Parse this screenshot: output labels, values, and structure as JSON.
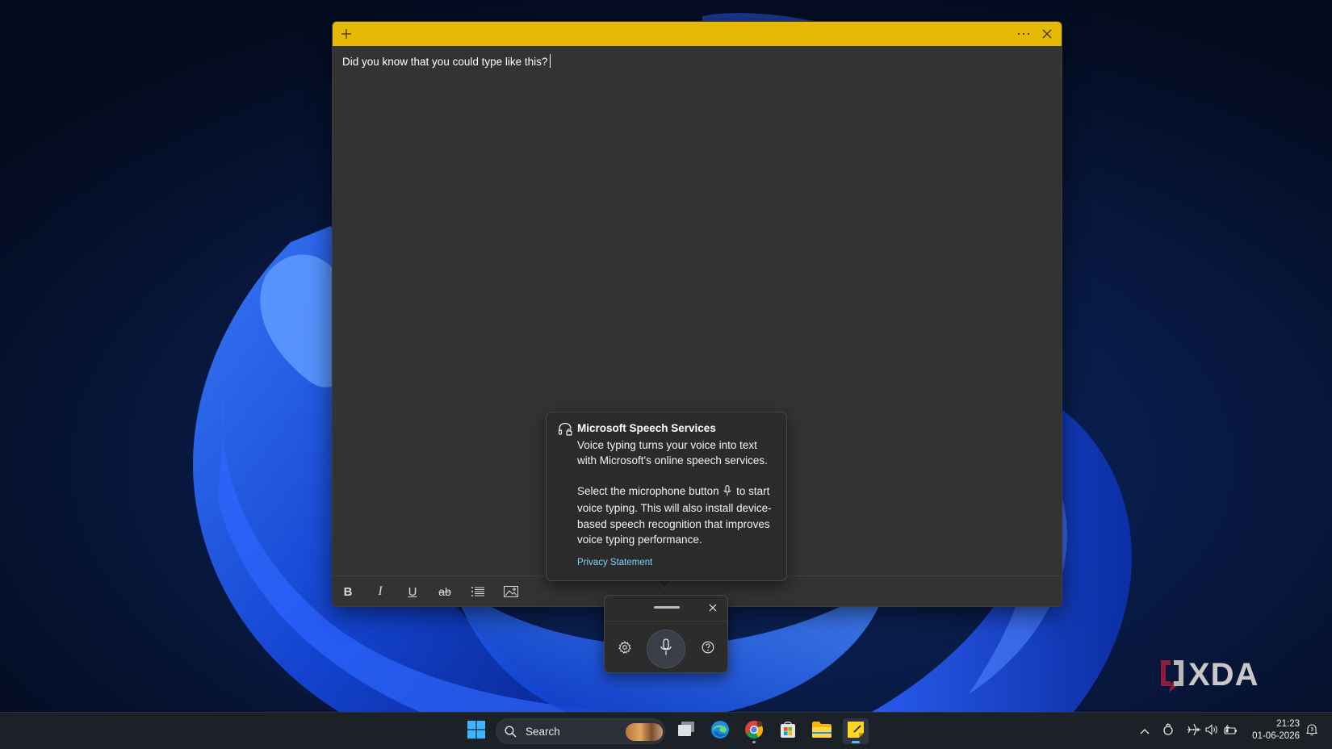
{
  "note": {
    "body_text": "Did you know that you could type like this?",
    "header_color": "#e6b906"
  },
  "toolbar": {
    "bold_label": "B",
    "italic_label": "I",
    "underline_label": "U",
    "strike_label": "ab"
  },
  "speech_tip": {
    "title": "Microsoft Speech Services",
    "text_line1": "Voice typing turns your voice into text with Microsoft's online speech services.",
    "text_part_before_icon": "Select the microphone button",
    "text_part_after_icon": "to start voice typing. This will also install device-based speech recognition that improves voice typing performance.",
    "link": "Privacy Statement",
    "link_color": "#7fd3f7"
  },
  "taskbar": {
    "search_placeholder": "Search",
    "time": "21:23",
    "date": "01-06-2026"
  },
  "watermark": {
    "text": "XDA"
  },
  "icons": {
    "note_header": [
      "plus-icon",
      "more-icon",
      "close-icon"
    ],
    "toolbar": [
      "bold-icon",
      "italic-icon",
      "underline-icon",
      "strikethrough-icon",
      "bullet-list-icon",
      "image-icon"
    ],
    "voice_panel": [
      "drag-handle",
      "close-icon",
      "settings-gear-icon",
      "microphone-icon",
      "help-icon"
    ],
    "taskbar": [
      "windows-start-icon",
      "search-icon",
      "task-view-icon",
      "edge-icon",
      "chrome-icon",
      "store-icon",
      "file-explorer-icon",
      "sticky-notes-icon"
    ],
    "tray": [
      "chevron-up-icon",
      "onedrive-icon",
      "airplane-icon",
      "volume-icon",
      "battery-icon",
      "notification-icon"
    ]
  }
}
